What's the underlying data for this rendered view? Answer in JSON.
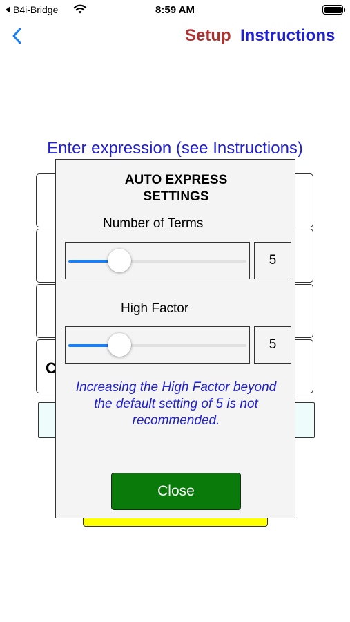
{
  "status_bar": {
    "back_app": "B4i-Bridge",
    "time": "8:59 AM"
  },
  "nav": {
    "setup_label": "Setup",
    "instructions_label": "Instructions"
  },
  "main": {
    "prompt": "Enter expression (see Instructions)",
    "partial_key_label": "C"
  },
  "dialog": {
    "title_line1": "AUTO EXPRESS",
    "title_line2": "SETTINGS",
    "terms_label": "Number of Terms",
    "terms_value": "5",
    "terms_fraction": 0.25,
    "high_factor_label": "High Factor",
    "high_factor_value": "5",
    "high_factor_fraction": 0.25,
    "note_line1": "Increasing the High Factor beyond",
    "note_line2": "the default setting of 5 is not",
    "note_line3": "recommended.",
    "close_label": "Close"
  },
  "colors": {
    "setup": "#b03030",
    "instructions": "#2020d0",
    "slider_fill": "#1a7ef5",
    "close_button": "#0a7a0a",
    "highlight_bar": "#ffff00"
  }
}
